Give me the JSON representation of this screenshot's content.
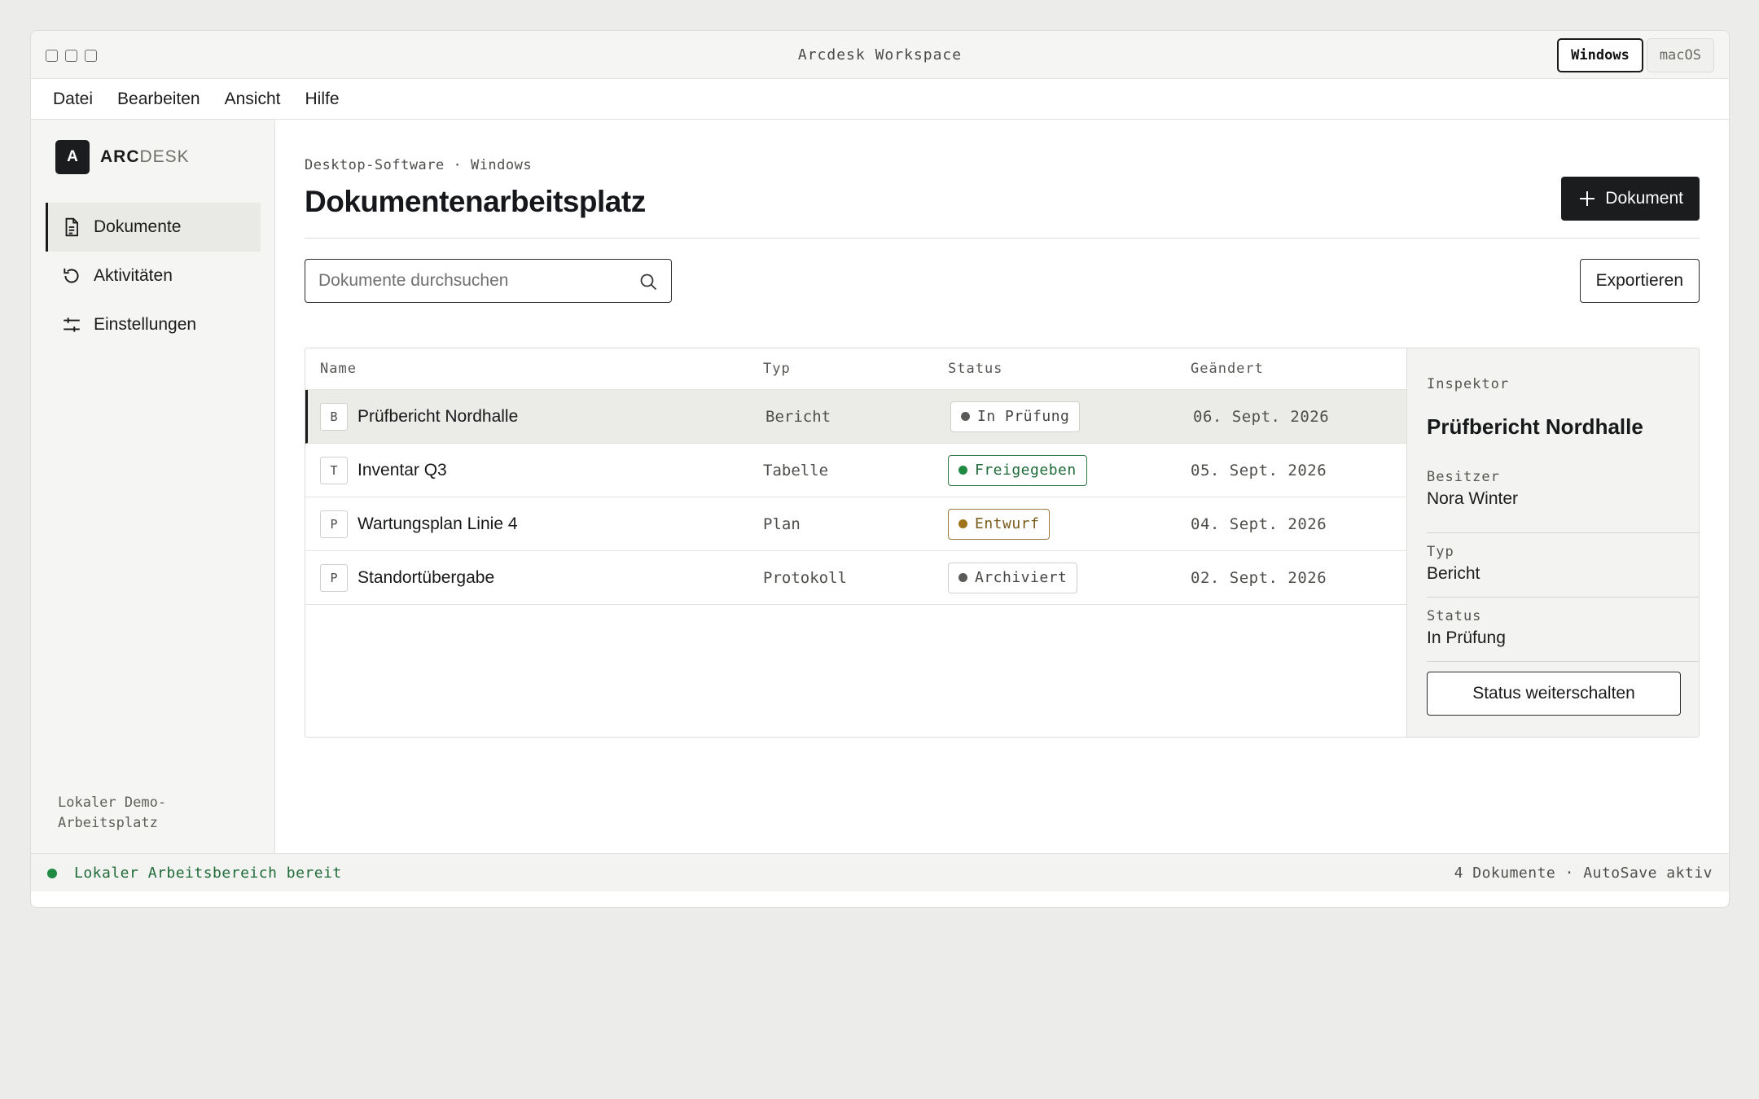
{
  "window": {
    "title": "Arcdesk Workspace"
  },
  "os_switch": {
    "windows": "Windows",
    "macos": "macOS"
  },
  "menu": [
    "Datei",
    "Bearbeiten",
    "Ansicht",
    "Hilfe"
  ],
  "brand": {
    "logo_letter": "A",
    "name_bold": "ARC",
    "name_light": "DESK"
  },
  "sidebar": {
    "items": [
      {
        "label": "Dokumente",
        "icon": "document-icon",
        "active": true
      },
      {
        "label": "Aktivitäten",
        "icon": "refresh-icon",
        "active": false
      },
      {
        "label": "Einstellungen",
        "icon": "sliders-icon",
        "active": false
      }
    ],
    "footer": "Lokaler Demo-Arbeitsplatz"
  },
  "header": {
    "breadcrumb": "Desktop-Software · Windows",
    "title": "Dokumentenarbeitsplatz",
    "new_button": "Dokument"
  },
  "search": {
    "placeholder": "Dokumente durchsuchen",
    "value": ""
  },
  "toolbar": {
    "export_label": "Exportieren"
  },
  "table": {
    "columns": [
      "Name",
      "Typ",
      "Status",
      "Geändert"
    ],
    "rows": [
      {
        "badge": "B",
        "name": "Prüfbericht Nordhalle",
        "type": "Bericht",
        "status": "In Prüfung",
        "date": "06. Sept. 2026"
      },
      {
        "badge": "T",
        "name": "Inventar Q3",
        "type": "Tabelle",
        "status": "Freigegeben",
        "date": "05. Sept. 2026"
      },
      {
        "badge": "P",
        "name": "Wartungsplan Linie 4",
        "type": "Plan",
        "status": "Entwurf",
        "date": "04. Sept. 2026"
      },
      {
        "badge": "P",
        "name": "Standortübergabe",
        "type": "Protokoll",
        "status": "Archiviert",
        "date": "02. Sept. 2026"
      }
    ]
  },
  "inspector": {
    "label": "Inspektor",
    "title": "Prüfbericht Nordhalle",
    "fields": [
      {
        "key": "Besitzer",
        "value": "Nora Winter"
      },
      {
        "key": "Typ",
        "value": "Bericht"
      },
      {
        "key": "Status",
        "value": "In Prüfung"
      }
    ],
    "action": "Status weiterschalten"
  },
  "statusbar": {
    "left": "Lokaler Arbeitsbereich bereit",
    "right": "4 Dokumente · AutoSave aktiv"
  },
  "colors": {
    "accent_dark": "#1a1c1e",
    "status_green": "#1f8a43",
    "status_amber": "#a0741b",
    "status_neutral": "#5a5a58"
  }
}
